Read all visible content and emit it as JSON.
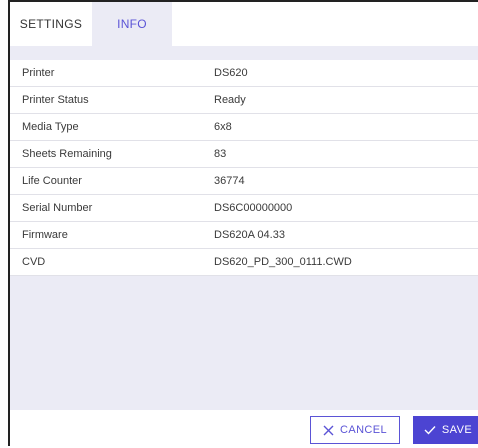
{
  "tabs": {
    "settings_label": "SETTINGS",
    "info_label": "INFO",
    "active": "INFO"
  },
  "info": {
    "rows": [
      {
        "label": "Printer",
        "value": "DS620"
      },
      {
        "label": "Printer Status",
        "value": "Ready"
      },
      {
        "label": "Media Type",
        "value": "6x8"
      },
      {
        "label": "Sheets Remaining",
        "value": "83"
      },
      {
        "label": "Life Counter",
        "value": "36774"
      },
      {
        "label": "Serial Number",
        "value": "DS6C00000000"
      },
      {
        "label": "Firmware",
        "value": "DS620A 04.33"
      },
      {
        "label": "CVD",
        "value": "DS620_PD_300_0111.CWD"
      }
    ]
  },
  "footer": {
    "cancel_label": "CANCEL",
    "save_label": "SAVE",
    "cancel_icon": "close-icon",
    "save_icon": "check-icon"
  },
  "colors": {
    "accent": "#5b54d6",
    "save_bg": "#4c44d2",
    "panel_bg": "#ebebf5"
  }
}
